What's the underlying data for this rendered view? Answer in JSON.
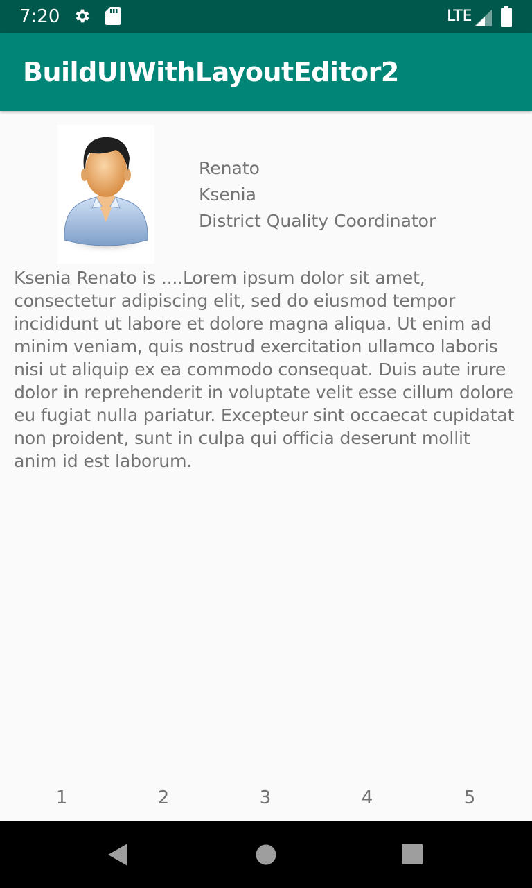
{
  "status_bar": {
    "time": "7:20",
    "network": "LTE",
    "icons": [
      "gear-icon",
      "sd-card-icon",
      "signal-icon",
      "battery-icon"
    ]
  },
  "app_bar": {
    "title": "BuildUIWithLayoutEditor2",
    "color": "#008577"
  },
  "profile": {
    "first_name": "Renato",
    "last_name": "Ksenia",
    "job_title": "District Quality Coordinator",
    "avatar_icon": "person-avatar-icon",
    "bio": "Ksenia Renato is ....Lorem ipsum dolor sit amet, consectetur adipiscing elit, sed do eiusmod tempor incididunt ut labore et dolore magna aliqua. Ut enim ad minim veniam, quis nostrud exercitation ullamco laboris nisi ut aliquip ex ea commodo consequat. Duis aute irure dolor in reprehenderit in voluptate velit esse cillum dolore eu fugiat nulla pariatur. Excepteur sint occaecat cupidatat non proident, sunt in culpa qui officia deserunt mollit anim id est laborum."
  },
  "bottom_items": [
    "1",
    "2",
    "3",
    "4",
    "5"
  ],
  "nav_bar": {
    "buttons": [
      "back-icon",
      "home-icon",
      "recents-icon"
    ]
  }
}
